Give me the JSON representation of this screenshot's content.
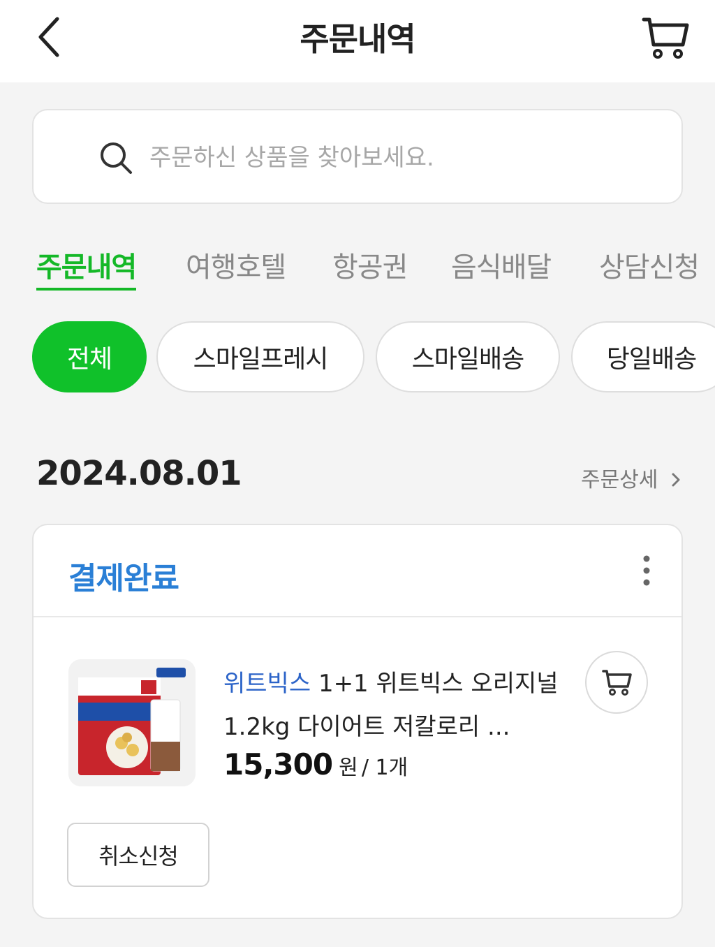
{
  "header": {
    "title": "주문내역",
    "back_icon": "chevron-left-icon",
    "cart_icon": "cart-icon"
  },
  "search": {
    "placeholder": "주문하신 상품을 찾아보세요.",
    "value": ""
  },
  "tabs": [
    {
      "label": "주문내역",
      "active": true
    },
    {
      "label": "여행호텔",
      "active": false
    },
    {
      "label": "항공권",
      "active": false
    },
    {
      "label": "음식배달",
      "active": false
    },
    {
      "label": "상담신청",
      "active": false
    }
  ],
  "filters": [
    {
      "label": "전체",
      "active": true
    },
    {
      "label": "스마일프레시",
      "active": false
    },
    {
      "label": "스마일배송",
      "active": false
    },
    {
      "label": "당일배송",
      "active": false
    }
  ],
  "order": {
    "date": "2024.08.01",
    "detail_link": "주문상세",
    "status": "결제완료",
    "item": {
      "brand": "위트빅스",
      "name": "1+1 위트빅스 오리지널 1.2kg 다이어트 저칼로리 ...",
      "price": "15,300",
      "currency": "원",
      "quantity": "/ 1개"
    },
    "cancel_label": "취소신청"
  },
  "colors": {
    "accent_green": "#10c12a",
    "status_blue": "#2a7fd6",
    "brand_blue": "#2b63c8"
  }
}
